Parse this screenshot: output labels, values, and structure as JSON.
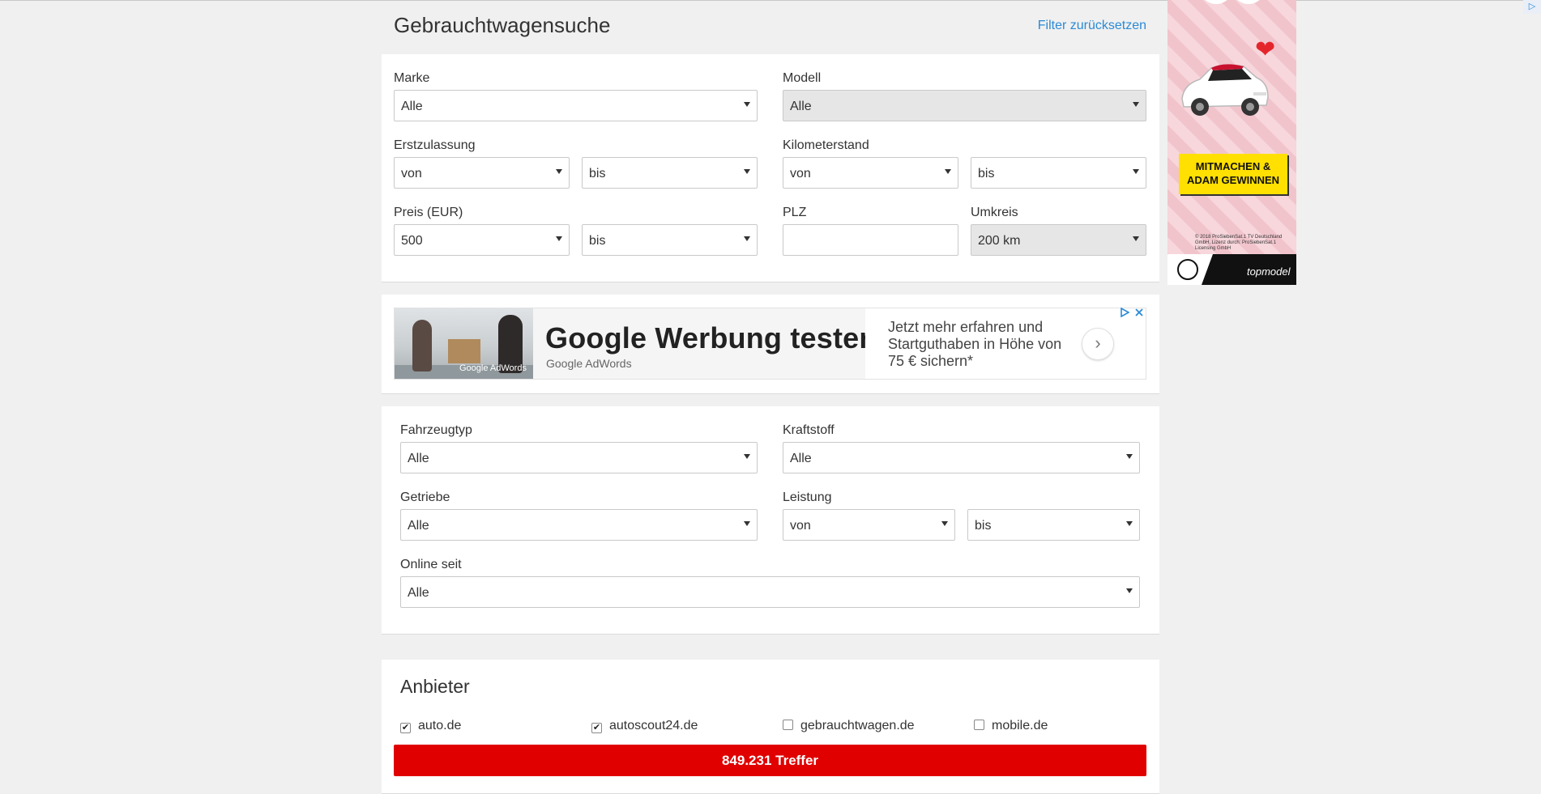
{
  "page": {
    "title": "Gebrauchtwagensuche",
    "reset_filters": "Filter zurücksetzen"
  },
  "basic_filters": {
    "make": {
      "label": "Marke",
      "value": "Alle"
    },
    "model": {
      "label": "Modell",
      "value": "Alle"
    },
    "first_registration": {
      "label": "Erstzulassung",
      "from": "von",
      "to": "bis"
    },
    "mileage": {
      "label": "Kilometerstand",
      "from": "von",
      "to": "bis"
    },
    "price": {
      "label": "Preis (EUR)",
      "from": "500",
      "to": "bis"
    },
    "zip": {
      "label": "PLZ",
      "value": ""
    },
    "radius": {
      "label": "Umkreis",
      "value": "200 km"
    }
  },
  "google_ad": {
    "headline": "Google Werbung testen",
    "advertiser": "Google AdWords",
    "image_watermark": "Google AdWords",
    "description": "Jetzt mehr erfahren und Startguthaben in Höhe von 75 € sichern*",
    "arrow": "›"
  },
  "advanced_filters": {
    "vehicle_type": {
      "label": "Fahrzeugtyp",
      "value": "Alle"
    },
    "fuel": {
      "label": "Kraftstoff",
      "value": "Alle"
    },
    "transmission": {
      "label": "Getriebe",
      "value": "Alle"
    },
    "power": {
      "label": "Leistung",
      "from": "von",
      "to": "bis"
    },
    "online_since": {
      "label": "Online seit",
      "value": "Alle"
    }
  },
  "providers": {
    "title": "Anbieter",
    "items": [
      {
        "label": "auto.de",
        "checked": true
      },
      {
        "label": "autoscout24.de",
        "checked": true
      },
      {
        "label": "gebrauchtwagen.de",
        "checked": false
      },
      {
        "label": "mobile.de",
        "checked": false
      }
    ],
    "check_mark": "✔"
  },
  "results_button": "849.231 Treffer",
  "side_ad": {
    "cta": "MITMACHEN & ADAM GEWINNEN",
    "legal": "© 2018 ProSiebenSat.1 TV Deutschland GmbH, Lizenz durch: ProSiebenSat.1 Licensing GmbH",
    "brand_footer": "topmodel",
    "heart": "❤"
  },
  "corner_ad_icon": "▷",
  "colors": {
    "accent_red": "#e00000",
    "link_blue": "#2a8ad6",
    "background": "#f0f0f0"
  }
}
